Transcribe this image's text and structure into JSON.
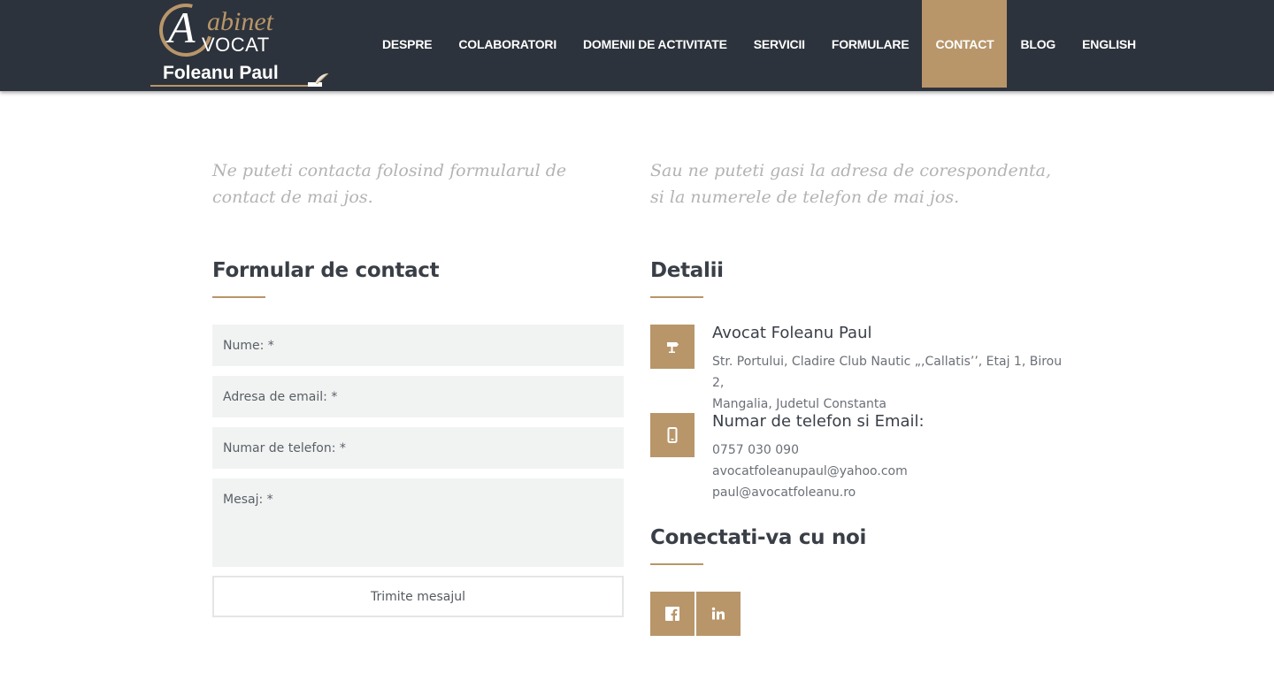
{
  "logo": {
    "cabinet": "abinet",
    "big_letter": "A",
    "vocat": "VOCAT",
    "name": "Foleanu Paul"
  },
  "nav": {
    "items": [
      "DESPRE",
      "COLABORATORI",
      "DOMENII DE ACTIVITATE",
      "SERVICII",
      "FORMULARE",
      "CONTACT",
      "BLOG",
      "ENGLISH"
    ],
    "active": "CONTACT"
  },
  "intro": {
    "left": "Ne puteti contacta folosind formularul de contact de mai jos.",
    "right": "Sau ne puteti gasi la adresa de corespondenta, si la numerele de telefon de mai jos."
  },
  "form": {
    "title": "Formular de contact",
    "name_placeholder": "Nume: *",
    "email_placeholder": "Adresa de email: *",
    "phone_placeholder": "Numar de telefon: *",
    "message_placeholder": "Mesaj: *",
    "submit_label": "Trimite mesajul"
  },
  "details": {
    "title": "Detalii",
    "address_title": "Avocat Foleanu Paul",
    "address_line1": "Str. Portului, Cladire Club Nautic „,Callatis’’, Etaj 1, Birou 2,",
    "address_line2": "Mangalia, Judetul Constanta",
    "contact_title": "Numar de telefon si Email:",
    "phone": "0757 030 090",
    "email1": "avocatfoleanupaul@yahoo.com",
    "email2": "paul@avocatfoleanu.ro"
  },
  "social": {
    "title": "Conectati-va cu noi",
    "icons": [
      "facebook-icon",
      "linkedin-icon"
    ]
  },
  "colors": {
    "header_bg": "#2d333c",
    "accent": "#b8966a",
    "field_bg": "#f1f3f2"
  }
}
